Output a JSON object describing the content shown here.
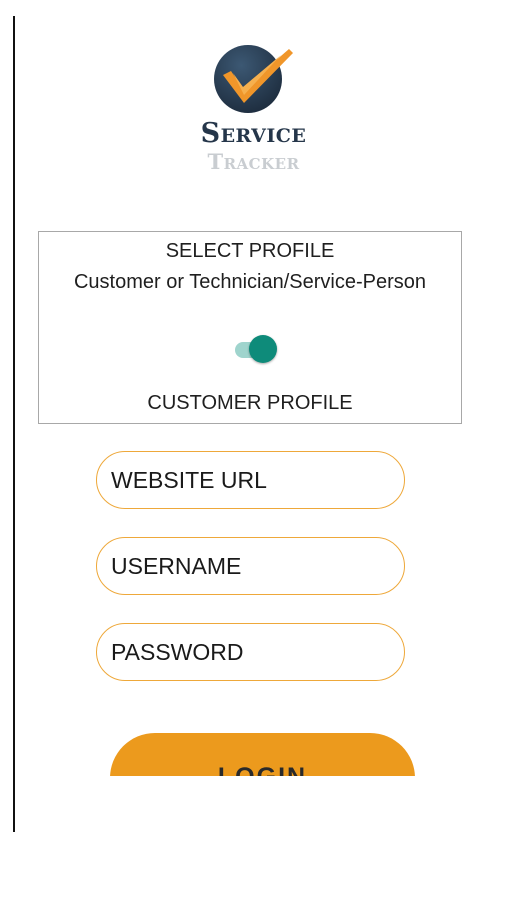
{
  "logo": {
    "icon": "checkmark-badge-icon",
    "line1": "Service",
    "line2": "Tracker",
    "colors": {
      "circle": "#2b3e52",
      "check": "#f0962a",
      "line1": "#25364a",
      "line2": "#c9cdd1"
    }
  },
  "profile_selector": {
    "title": "SELECT PROFILE",
    "subtitle": "Customer or Technician/Service-Person",
    "toggle_on": true,
    "selected_label": "CUSTOMER PROFILE",
    "colors": {
      "track": "#9fd4cd",
      "thumb": "#0e8b7a",
      "border": "#a8a8a8"
    }
  },
  "form": {
    "website_url_placeholder": "WEBSITE URL",
    "username_placeholder": "USERNAME",
    "password_placeholder": "PASSWORD",
    "field_border_color": "#eea83a"
  },
  "login": {
    "label": "LOGIN",
    "color": "#ec9a1d"
  }
}
